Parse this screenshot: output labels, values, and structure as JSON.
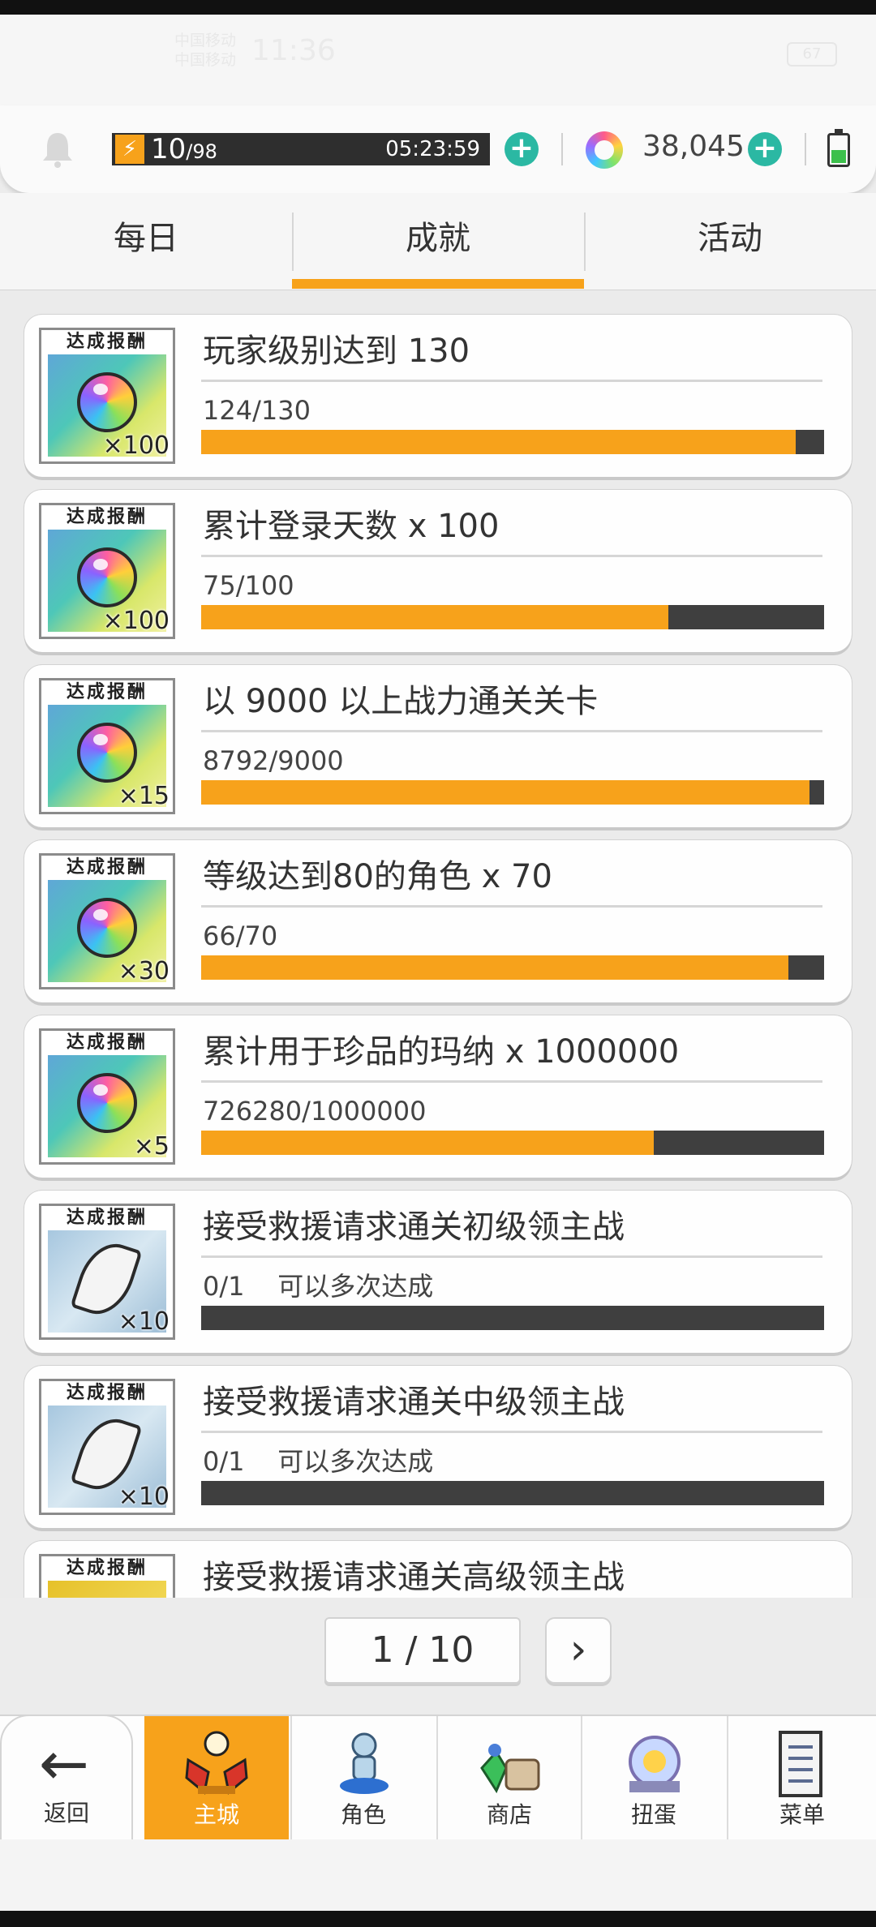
{
  "status_bar": {
    "carrier1": "中国移动",
    "carrier2": "中国移动",
    "time": "11:36",
    "battery": "67"
  },
  "resources": {
    "stamina_current": "10",
    "stamina_max": "/98",
    "timer": "05:23:59",
    "gems": "38,045"
  },
  "tabs": [
    {
      "label": "每日",
      "active": false
    },
    {
      "label": "成就",
      "active": true
    },
    {
      "label": "活动",
      "active": false
    }
  ],
  "reward_header": "达成报酬",
  "achievements": [
    {
      "title": "玩家级别达到 130",
      "progress": "124/130",
      "fill": 0.954,
      "reward": "×100",
      "icon": "rainbow-orb-icon"
    },
    {
      "title": "累计登录天数  x 100",
      "progress": "75/100",
      "fill": 0.75,
      "reward": "×100",
      "icon": "rainbow-orb-icon"
    },
    {
      "title": "以 9000 以上战力通关关卡",
      "progress": "8792/9000",
      "fill": 0.977,
      "reward": "×15",
      "icon": "rainbow-orb-icon"
    },
    {
      "title": "等级达到80的角色  x 70",
      "progress": "66/70",
      "fill": 0.943,
      "reward": "×30",
      "icon": "rainbow-orb-icon"
    },
    {
      "title": "累计用于珍品的玛纳  x 1000000",
      "progress": "726280/1000000",
      "fill": 0.726,
      "reward": "×5",
      "icon": "rainbow-orb-icon"
    },
    {
      "title": "接受救援请求通关初级领主战",
      "progress": "0/1    可以多次达成",
      "fill": 0,
      "reward": "×10",
      "icon": "silver-claw-icon"
    },
    {
      "title": "接受救援请求通关中级领主战",
      "progress": "0/1    可以多次达成",
      "fill": 0,
      "reward": "×10",
      "icon": "silver-claw-icon"
    },
    {
      "title": "接受救援请求通关高级领主战",
      "progress": "",
      "fill": 0,
      "reward": "",
      "icon": "gold-item-icon"
    }
  ],
  "pager": {
    "label": "1 / 10",
    "next": "›"
  },
  "nav": {
    "back": "返回",
    "items": [
      {
        "label": "主城",
        "icon": "castle-icon",
        "active": true
      },
      {
        "label": "角色",
        "icon": "character-icon",
        "active": false
      },
      {
        "label": "商店",
        "icon": "shop-icon",
        "active": false
      },
      {
        "label": "扭蛋",
        "icon": "gacha-icon",
        "active": false
      },
      {
        "label": "菜单",
        "icon": "menu-icon",
        "active": false
      }
    ]
  },
  "colors": {
    "accent": "#f7a21b",
    "teal": "#2bb8a3",
    "bar_bg": "#3f3f3f"
  }
}
